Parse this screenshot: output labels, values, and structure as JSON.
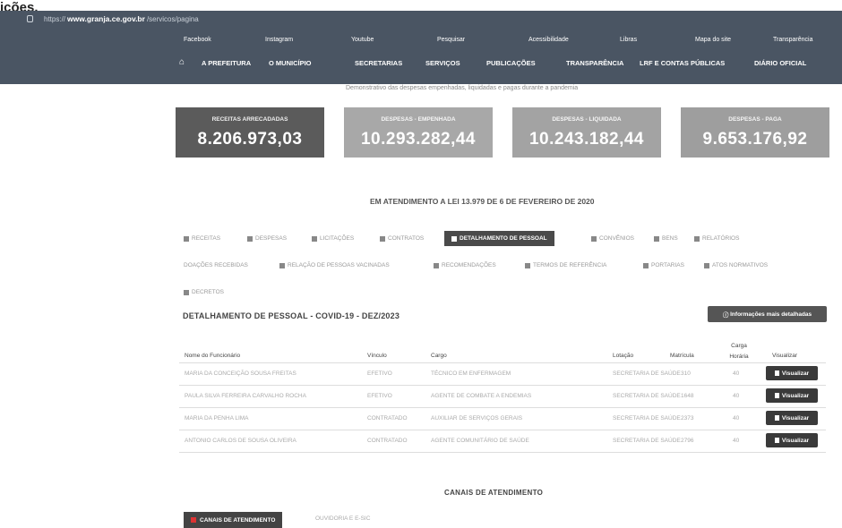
{
  "corner_text": "ições.",
  "browser": {
    "url_prefix": "https://",
    "url_domain": "www.granja.ce.gov.br",
    "url_path": "/servicos/pagina"
  },
  "access_bar": [
    "Facebook",
    "Instagram",
    "Youtube",
    "Pesquisar",
    "Acessibilidade",
    "Libras",
    "Mapa do site",
    "Transparência"
  ],
  "nav": [
    "A PREFEITURA",
    "O MUNICÍPIO",
    "SECRETARIAS",
    "SERVIÇOS",
    "PUBLICAÇÕES",
    "TRANSPARÊNCIA",
    "LRF E CONTAS PÚBLICAS",
    "DIÁRIO OFICIAL"
  ],
  "notice": "Demonstrativo das despesas empenhadas, liquidadas e pagas durante a pandemia",
  "cards": [
    {
      "title": "RECEITAS ARRECADADAS",
      "value": "8.206.973,03",
      "color": "#5b5b5b"
    },
    {
      "title": "DESPESAS - EMPENHADA",
      "value": "10.293.282,44",
      "color": "#a8a8a8"
    },
    {
      "title": "DESPESAS - LIQUIDADA",
      "value": "10.243.182,44",
      "color": "#a3a3a3"
    },
    {
      "title": "DESPESAS - PAGA",
      "value": "9.653.176,92",
      "color": "#9e9e9e"
    }
  ],
  "law": "EM ATENDIMENTO A LEI 13.979 DE 6 DE FEVEREIRO DE 2020",
  "tabs_row1": [
    "RECEITAS",
    "DESPESAS",
    "LICITAÇÕES",
    "CONTRATOS",
    "DETALHAMENTO DE PESSOAL",
    "CONVÊNIOS",
    "BENS",
    "RELATÓRIOS"
  ],
  "tabs_row2": [
    "DOAÇÕES RECEBIDAS",
    "RELAÇÃO DE PESSOAS VACINADAS",
    "RECOMENDAÇÕES",
    "TERMOS DE REFERÊNCIA",
    "PORTARIAS",
    "ATOS NORMATIVOS"
  ],
  "tabs_row3": [
    "DECRETOS"
  ],
  "section_title": "DETALHAMENTO DE PESSOAL - COVID-19 - DEZ/2023",
  "more_button": "Informações mais detalhadas",
  "table": {
    "headers": [
      "Nome do Funcionário",
      "Vínculo",
      "Cargo",
      "Lotação",
      "Matrícula",
      "Carga Horária",
      "Visualizar"
    ],
    "rows": [
      [
        "MARIA DA CONCEIÇÃO SOUSA FREITAS",
        "EFETIVO",
        "TÉCNICO EM ENFERMAGEM",
        "SECRETARIA DE SAÚDE",
        "310",
        "40",
        "Visualizar"
      ],
      [
        "PAULA SILVA FERREIRA CARVALHO ROCHA",
        "EFETIVO",
        "AGENTE DE COMBATE A ENDEMIAS",
        "SECRETARIA DE SAÚDE",
        "1648",
        "40",
        "Visualizar"
      ],
      [
        "MARIA DA PENHA LIMA",
        "CONTRATADO",
        "AUXILIAR DE SERVIÇOS GERAIS",
        "SECRETARIA DE SAÚDE",
        "2373",
        "40",
        "Visualizar"
      ],
      [
        "ANTONIO CARLOS DE SOUSA OLIVEIRA",
        "CONTRATADO",
        "AGENTE COMUNITÁRIO DE SAÚDE",
        "SECRETARIA DE SAÚDE",
        "2796",
        "40",
        "Visualizar"
      ]
    ]
  },
  "canais_title": "CANAIS DE ATENDIMENTO",
  "canais_tab": "CANAIS DE ATENDIMENTO",
  "canais_tab2": "OUVIDORIA E E-SIC"
}
